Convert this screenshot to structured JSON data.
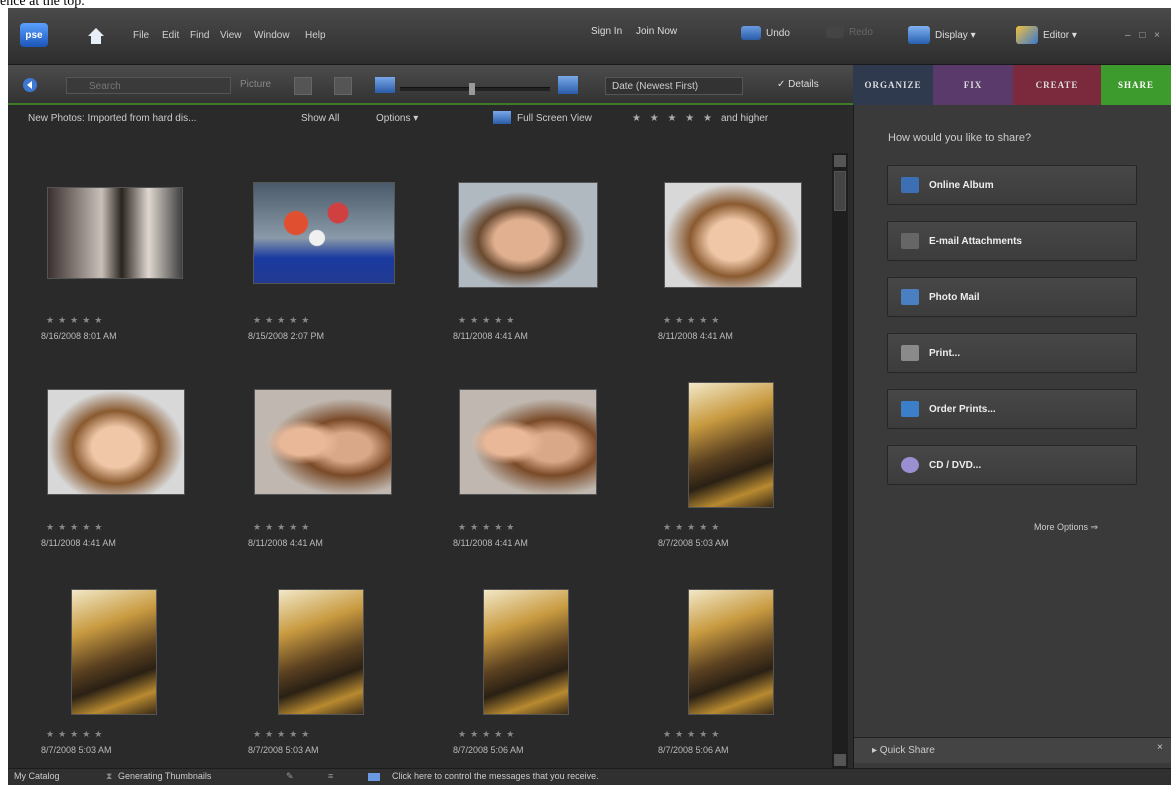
{
  "caption": "ence at the top.",
  "app": {
    "logo": "pse"
  },
  "menu": [
    "File",
    "Edit",
    "Find",
    "View",
    "Window",
    "Help"
  ],
  "header": {
    "sign_in": "Sign In",
    "join_now": "Join Now",
    "undo": "Undo",
    "redo": "Redo",
    "display": "Display ▾",
    "editor": "Editor ▾",
    "window_controls": "– □ ×"
  },
  "toolbar": {
    "search_placeholder": "Search",
    "picture_label": "Picture",
    "sort": "Date (Newest First)",
    "details": "✓ Details",
    "zoom_level_fraction": 0.48
  },
  "tabs": [
    {
      "label": "ORGANIZE",
      "color": "#2f3a4f"
    },
    {
      "label": "FIX",
      "color": "#5a3a6a"
    },
    {
      "label": "CREATE",
      "color": "#7a2a3c"
    },
    {
      "label": "SHARE",
      "color": "#3d9a2c"
    }
  ],
  "infobar": {
    "source": "New Photos: Imported from hard dis...",
    "show_all": "Show All",
    "options": "Options ▾",
    "full_screen": "Full Screen View",
    "rating_stars": "★ ★ ★ ★ ★",
    "and_higher": "and higher"
  },
  "photos": [
    {
      "stars": "★★★★★",
      "date": "8/16/2008 8:01 AM",
      "kind": "bw"
    },
    {
      "stars": "★★★★★",
      "date": "8/15/2008 2:07 PM",
      "kind": "balloons"
    },
    {
      "stars": "★★★★★",
      "date": "8/11/2008 4:41 AM",
      "kind": "boy"
    },
    {
      "stars": "★★★★★",
      "date": "8/11/2008 4:41 AM",
      "kind": "girl"
    },
    {
      "stars": "★★★★★",
      "date": "8/11/2008 4:41 AM",
      "kind": "girl"
    },
    {
      "stars": "★★★★★",
      "date": "8/11/2008 4:41 AM",
      "kind": "pair"
    },
    {
      "stars": "★★★★★",
      "date": "8/11/2008 4:41 AM",
      "kind": "pair"
    },
    {
      "stars": "★★★★★",
      "date": "8/7/2008 5:03 AM",
      "kind": "room"
    },
    {
      "stars": "★★★★★",
      "date": "8/7/2008 5:03 AM",
      "kind": "room"
    },
    {
      "stars": "★★★★★",
      "date": "8/7/2008 5:03 AM",
      "kind": "room"
    },
    {
      "stars": "★★★★★",
      "date": "8/7/2008 5:06 AM",
      "kind": "room"
    },
    {
      "stars": "★★★★★",
      "date": "8/7/2008 5:06 AM",
      "kind": "room"
    }
  ],
  "share": {
    "title": "How would you like to share?",
    "options": [
      {
        "label": "Online Album",
        "icon": "online-album-icon",
        "color": "#3d6fb5"
      },
      {
        "label": "E-mail Attachments",
        "icon": "paperclip-icon",
        "color": "#666666"
      },
      {
        "label": "Photo Mail",
        "icon": "photo-mail-icon",
        "color": "#4a7fc1"
      },
      {
        "label": "Print...",
        "icon": "printer-icon",
        "color": "#8a8a8a"
      },
      {
        "label": "Order Prints...",
        "icon": "order-prints-icon",
        "color": "#3a7fc8"
      },
      {
        "label": "CD / DVD...",
        "icon": "disc-icon",
        "color": "#9a8fd0"
      }
    ],
    "more_options": "More Options ⇒",
    "quick_share": "▸ Quick Share",
    "quick_close": "×"
  },
  "status": {
    "catalog": "My Catalog",
    "generating": "Generating Thumbnails",
    "message": "Click here to control the messages that you receive."
  }
}
